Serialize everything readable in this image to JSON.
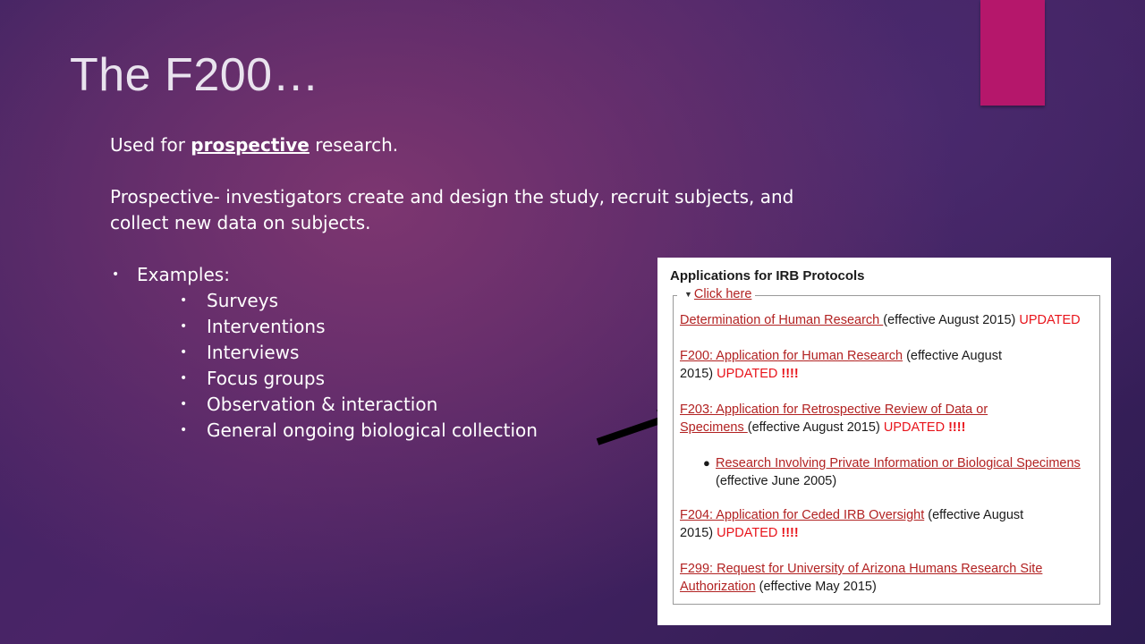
{
  "slide": {
    "title": "The F200…",
    "accent_color": "#b5176b",
    "intro_prefix": "Used for ",
    "intro_emph": "prospective",
    "intro_suffix": " research.",
    "definition_line1": "Prospective- investigators create and design the study, recruit subjects, and",
    "definition_line2": "collect new data on subjects.",
    "examples_label": "Examples:",
    "examples": [
      "Surveys",
      "Interventions",
      "Interviews",
      "Focus groups",
      "Observation & interaction",
      "General ongoing biological collection"
    ]
  },
  "irb_panel": {
    "heading": "Applications for IRB Protocols",
    "toggle_label": "Click here",
    "items": [
      {
        "link": "Determination of Human Research ",
        "detail": "(effective August 2015) ",
        "status": "UPDATED",
        "bang": ""
      },
      {
        "link": "F200: Application for Human Research",
        "detail_line1": " (effective August",
        "detail_line2": "2015) ",
        "status": "UPDATED",
        "bang": " !!!!"
      },
      {
        "link_line1": "F203: Application for Retrospective Review of Data or",
        "link_line2": "Specimens ",
        "detail": "(effective August 2015) ",
        "status": "UPDATED",
        "bang": " !!!!"
      },
      {
        "link": "Research Involving Private Information or Biological Specimens",
        "detail": "(effective June 2005)"
      },
      {
        "link": "F204: Application for Ceded IRB Oversight",
        "detail_line1": " (effective August",
        "detail_line2": "2015) ",
        "status": "UPDATED",
        "bang": " !!!!"
      },
      {
        "link_line1": "F299: Request for University of Arizona Humans Research Site",
        "link_line2": "Authorization",
        "detail": " (effective May 2015)"
      }
    ],
    "link_color": "#b22222",
    "status_color": "#e8141b"
  }
}
